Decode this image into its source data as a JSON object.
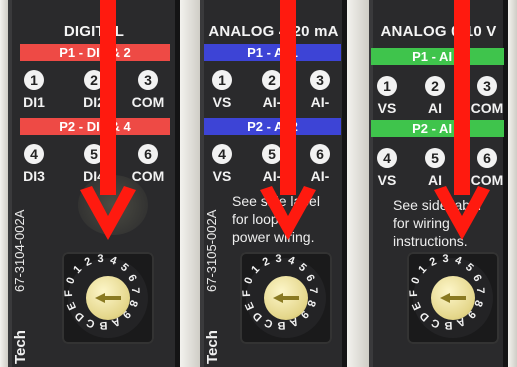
{
  "modules": [
    {
      "title": "DIGITAL",
      "band1": "P1 - DI1 & 2",
      "band2": "P2 - DI3 & 4",
      "band_color": "#ee4a45",
      "row1": [
        {
          "num": "1",
          "label": "DI1"
        },
        {
          "num": "2",
          "label": "DI2"
        },
        {
          "num": "3",
          "label": "COM"
        }
      ],
      "row2": [
        {
          "num": "4",
          "label": "DI3"
        },
        {
          "num": "5",
          "label": "DI4"
        },
        {
          "num": "6",
          "label": "COM"
        }
      ],
      "note": [],
      "part_number": "67-3104-002A",
      "brand": "Tech"
    },
    {
      "title": "ANALOG 4-20 mA",
      "band1": "P1 - AI 1",
      "band2": "P2 - AI 2",
      "band_color": "#3d44d6",
      "row1": [
        {
          "num": "1",
          "label": "VS"
        },
        {
          "num": "2",
          "label": "AI-"
        },
        {
          "num": "3",
          "label": "AI-"
        }
      ],
      "row2": [
        {
          "num": "4",
          "label": "VS"
        },
        {
          "num": "5",
          "label": "AI-"
        },
        {
          "num": "6",
          "label": "AI-"
        }
      ],
      "note": [
        "See side label",
        "for loop",
        "power wiring."
      ],
      "part_number": "67-3105-002A",
      "brand": "Tech"
    },
    {
      "title": "ANALOG 0-10 V",
      "band1": "P1 - AI 1",
      "band2": "P2 - AI 2",
      "band_color": "#3fc44c",
      "row1": [
        {
          "num": "1",
          "label": "VS"
        },
        {
          "num": "2",
          "label": "AI"
        },
        {
          "num": "3",
          "label": "COM"
        }
      ],
      "row2": [
        {
          "num": "4",
          "label": "VS"
        },
        {
          "num": "5",
          "label": "AI"
        },
        {
          "num": "6",
          "label": "COM"
        }
      ],
      "note": [
        "See side label",
        "for wiring",
        "instructions."
      ],
      "part_number": "67-3106-002A",
      "brand": "Tech"
    }
  ],
  "dial_chars": [
    "0",
    "1",
    "2",
    "3",
    "4",
    "5",
    "6",
    "7",
    "8",
    "9",
    "A",
    "B",
    "C",
    "D",
    "E",
    "F"
  ],
  "colors": {
    "pointer_arrow": "#ff1a0f",
    "module_body": "#2a2a2c",
    "knob": "#ece0a0"
  },
  "icons": [
    "down-arrow-pointer-icon",
    "rotary-switch-arrow-icon"
  ]
}
